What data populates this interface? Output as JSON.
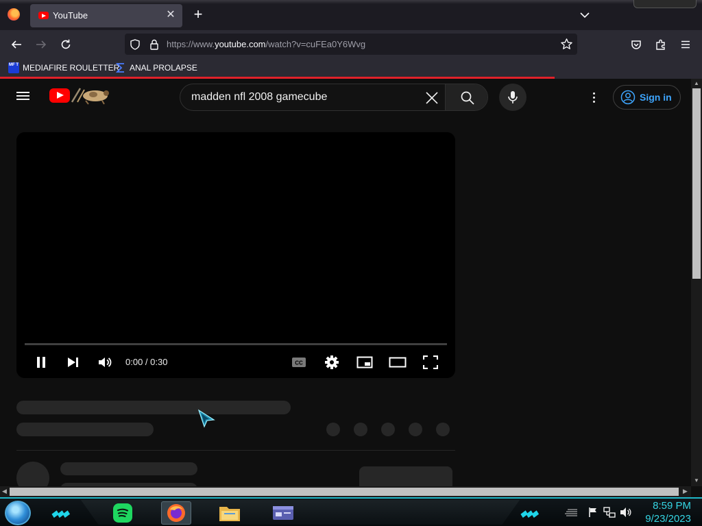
{
  "browser": {
    "tab": {
      "title": "YouTube",
      "close_symbol": "✕"
    },
    "new_tab_symbol": "+",
    "url": {
      "prefix": "https://www.",
      "domain": "youtube.com",
      "path": "/watch?v=cuFEa0Y6Wvg"
    },
    "bookmarks": [
      {
        "label": "MEDIAFIRE ROULETTER",
        "icon": "mediafire-bookmark-icon",
        "icon_text": "MF T"
      },
      {
        "label": "ANAL PROLAPSE",
        "icon": "sigma-bookmark-icon"
      }
    ],
    "page_load_progress": 0.79,
    "accent": "#e0212a"
  },
  "youtube": {
    "search_value": "madden nfl 2008 gamecube",
    "sign_in_label": "Sign in",
    "player": {
      "time": "0:00 / 0:30",
      "playing": true
    },
    "brand_color": "#ff0000",
    "link_color": "#3ea6ff"
  },
  "taskbar": {
    "clock_time": "8:59 PM",
    "clock_date": "9/23/2023",
    "accent": "#1fd4e8",
    "apps": [
      "spotify-icon",
      "firefox-icon",
      "file-explorer-icon",
      "window-app-icon"
    ]
  }
}
